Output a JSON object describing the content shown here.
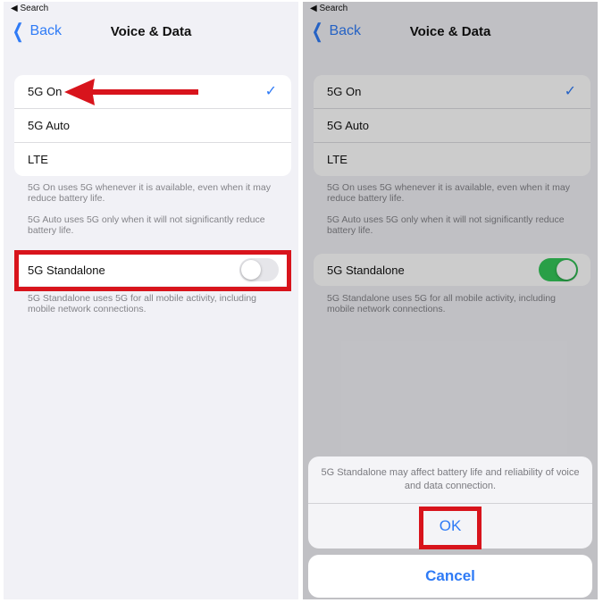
{
  "status": {
    "back_app": "Search"
  },
  "nav": {
    "back_label": "Back",
    "title": "Voice & Data"
  },
  "options": [
    {
      "label": "5G On",
      "selected": true
    },
    {
      "label": "5G Auto",
      "selected": false
    },
    {
      "label": "LTE",
      "selected": false
    }
  ],
  "footnotes": {
    "on": "5G On uses 5G whenever it is available, even when it may reduce battery life.",
    "auto": "5G Auto uses 5G only when it will not significantly reduce battery life.",
    "standalone": "5G Standalone uses 5G for all mobile activity, including mobile network connections."
  },
  "standalone": {
    "label": "5G Standalone",
    "left_on": false,
    "right_on": true
  },
  "alert": {
    "message": "5G Standalone may affect battery life and reliability of voice and data connection.",
    "ok_label": "OK",
    "cancel_label": "Cancel"
  },
  "colors": {
    "accent": "#2f7bf6",
    "highlight": "#d8141c",
    "toggle_on": "#34c759"
  }
}
